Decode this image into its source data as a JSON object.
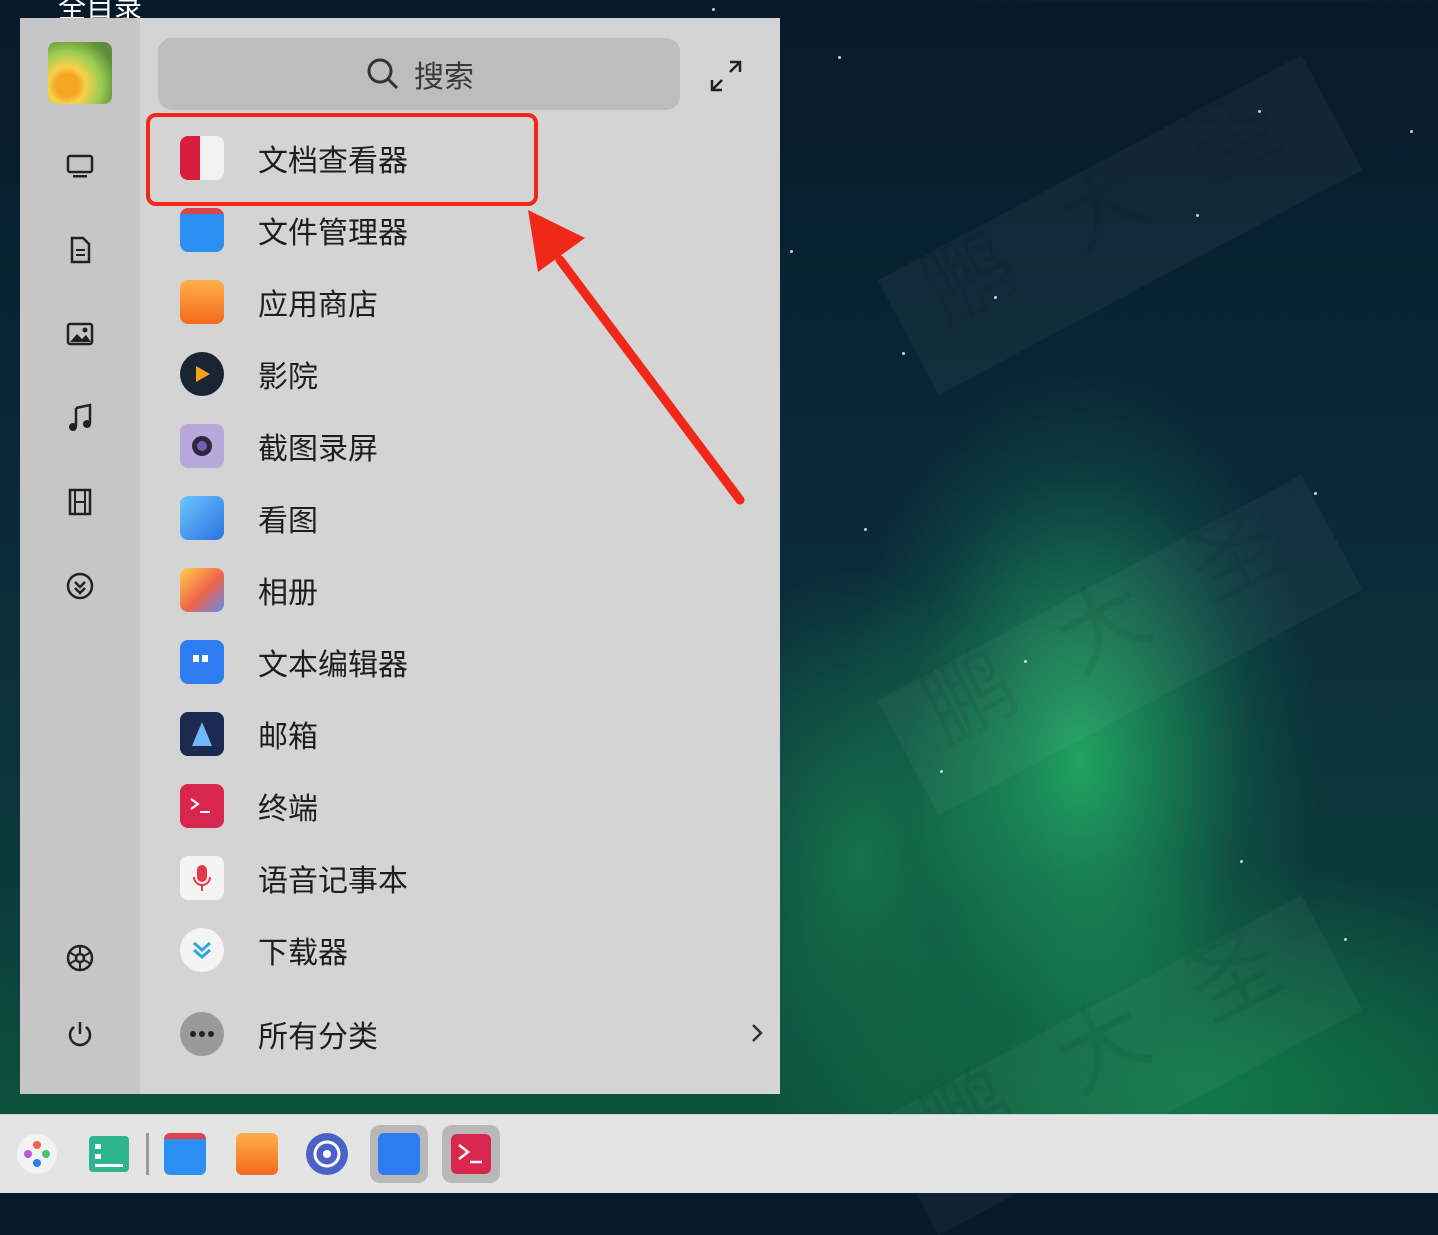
{
  "desktop": {
    "top_label": "全目录",
    "accent": "#f02818"
  },
  "launcher": {
    "search_placeholder": "搜索",
    "apps": [
      {
        "label": "文档查看器",
        "icon": "document-viewer-icon"
      },
      {
        "label": "文件管理器",
        "icon": "file-manager-icon"
      },
      {
        "label": "应用商店",
        "icon": "app-store-icon"
      },
      {
        "label": "影院",
        "icon": "movie-player-icon"
      },
      {
        "label": "截图录屏",
        "icon": "screenshot-icon"
      },
      {
        "label": "看图",
        "icon": "image-viewer-icon"
      },
      {
        "label": "相册",
        "icon": "album-icon"
      },
      {
        "label": "文本编辑器",
        "icon": "text-editor-icon"
      },
      {
        "label": "邮箱",
        "icon": "mail-icon"
      },
      {
        "label": "终端",
        "icon": "terminal-icon"
      },
      {
        "label": "语音记事本",
        "icon": "voice-notes-icon"
      },
      {
        "label": "下载器",
        "icon": "downloader-icon"
      }
    ],
    "all_categories": "所有分类",
    "rail": [
      "computer-icon",
      "document-icon",
      "picture-icon",
      "music-icon",
      "video-icon",
      "download-icon",
      "settings-icon",
      "power-icon"
    ]
  },
  "watermark": {
    "text": "鹏大圣"
  },
  "taskbar": {
    "items": [
      "launcher-icon",
      "multitask-icon",
      "file-manager-icon",
      "app-store-icon",
      "control-center-icon",
      "text-editor-icon",
      "terminal-icon"
    ]
  }
}
